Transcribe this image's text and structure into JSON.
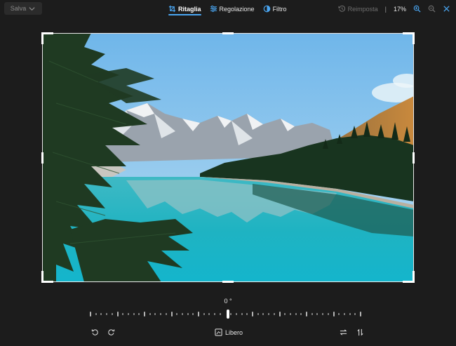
{
  "toolbar": {
    "save_label": "Salva",
    "tabs": [
      {
        "label": "Ritaglia",
        "active": true
      },
      {
        "label": "Regolazione",
        "active": false
      },
      {
        "label": "Filtro",
        "active": false
      }
    ],
    "reset_label": "Reimposta",
    "separator": "|",
    "zoom_level": "17%"
  },
  "straighten": {
    "angle_label": "0 °",
    "angle_value": 0
  },
  "bottom": {
    "aspect_label": "Libero"
  },
  "colors": {
    "accent": "#4aa6f2",
    "background": "#1c1c1c"
  },
  "icons": [
    "chevron-down-icon",
    "crop-icon",
    "adjust-sliders-icon",
    "filter-icon",
    "reset-history-icon",
    "zoom-in-icon",
    "zoom-out-icon",
    "close-icon",
    "rotate-left-icon",
    "rotate-right-icon",
    "aspect-ratio-icon",
    "flip-horizontal-icon",
    "flip-vertical-icon"
  ]
}
